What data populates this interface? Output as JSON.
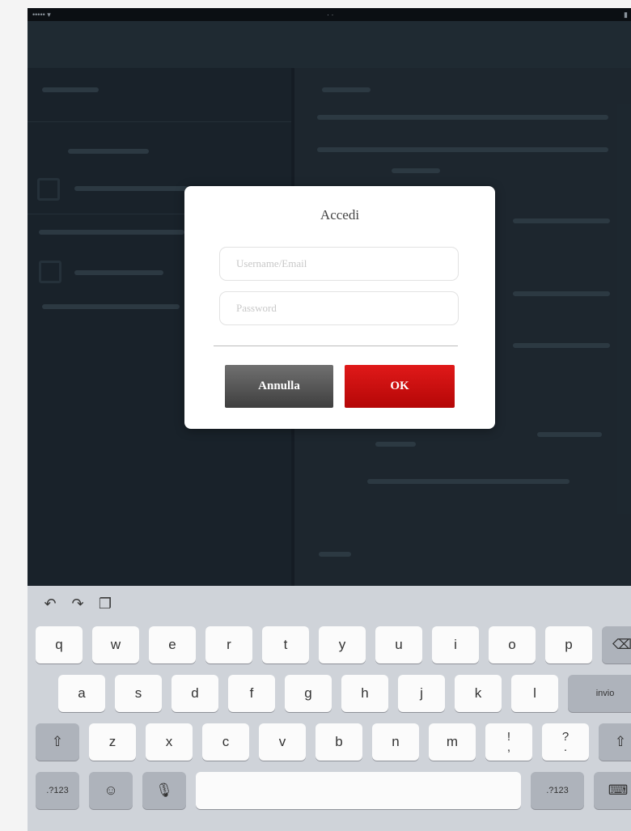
{
  "dialog": {
    "title": "Accedi",
    "username_placeholder": "Username/Email",
    "password_placeholder": "Password",
    "cancel_label": "Annulla",
    "ok_label": "OK"
  },
  "colors": {
    "ok_button": "#c80b0b",
    "cancel_button": "#555555",
    "background": "#1f2a33",
    "keyboard": "#cfd3d9"
  },
  "keyboard": {
    "tools": [
      "undo-icon",
      "redo-icon",
      "paste-icon"
    ],
    "row1": [
      "q",
      "w",
      "e",
      "r",
      "t",
      "y",
      "u",
      "i",
      "o",
      "p"
    ],
    "row2": [
      "a",
      "s",
      "d",
      "f",
      "g",
      "h",
      "j",
      "k",
      "l"
    ],
    "row3": [
      "z",
      "x",
      "c",
      "v",
      "b",
      "n",
      "m"
    ],
    "punct": [
      {
        "top": "!",
        "bottom": ","
      },
      {
        "top": "?",
        "bottom": "."
      }
    ],
    "return_label": "invio",
    "numbers_label": ".?123",
    "icons": {
      "delete": "⌫",
      "shift": "⇧",
      "emoji": "☺",
      "mic": "🎙",
      "hide": "⌨"
    }
  }
}
